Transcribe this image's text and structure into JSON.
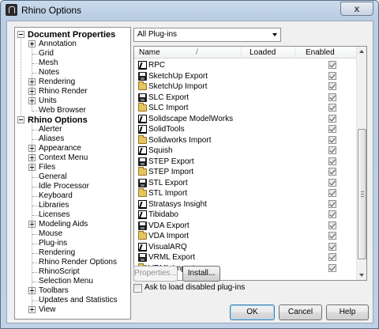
{
  "window": {
    "title": "Rhino Options",
    "close_label": "x"
  },
  "tree": {
    "items": [
      {
        "label": "Document Properties",
        "bold": true,
        "level": 0,
        "expander": "minus"
      },
      {
        "label": "Annotation",
        "level": 1,
        "expander": "plus"
      },
      {
        "label": "Grid",
        "level": 1
      },
      {
        "label": "Mesh",
        "level": 1
      },
      {
        "label": "Notes",
        "level": 1
      },
      {
        "label": "Rendering",
        "level": 1,
        "expander": "plus"
      },
      {
        "label": "Rhino Render",
        "level": 1,
        "expander": "plus"
      },
      {
        "label": "Units",
        "level": 1,
        "expander": "plus"
      },
      {
        "label": "Web Browser",
        "level": 1
      },
      {
        "label": "Rhino Options",
        "bold": true,
        "level": 0,
        "expander": "minus"
      },
      {
        "label": "Alerter",
        "level": 1
      },
      {
        "label": "Aliases",
        "level": 1
      },
      {
        "label": "Appearance",
        "level": 1,
        "expander": "plus"
      },
      {
        "label": "Context Menu",
        "level": 1,
        "expander": "plus"
      },
      {
        "label": "Files",
        "level": 1,
        "expander": "plus"
      },
      {
        "label": "General",
        "level": 1
      },
      {
        "label": "Idle Processor",
        "level": 1
      },
      {
        "label": "Keyboard",
        "level": 1
      },
      {
        "label": "Libraries",
        "level": 1
      },
      {
        "label": "Licenses",
        "level": 1
      },
      {
        "label": "Modeling Aids",
        "level": 1,
        "expander": "plus"
      },
      {
        "label": "Mouse",
        "level": 1
      },
      {
        "label": "Plug-ins",
        "level": 1
      },
      {
        "label": "Rendering",
        "level": 1
      },
      {
        "label": "Rhino Render Options",
        "level": 1
      },
      {
        "label": "RhinoScript",
        "level": 1
      },
      {
        "label": "Selection Menu",
        "level": 1
      },
      {
        "label": "Toolbars",
        "level": 1,
        "expander": "plus"
      },
      {
        "label": "Updates and Statistics",
        "level": 1
      },
      {
        "label": "View",
        "level": 1,
        "expander": "plus"
      }
    ]
  },
  "filter": {
    "selected": "All Plug-ins"
  },
  "plugin_list": {
    "columns": [
      "Name",
      "Loaded",
      "Enabled"
    ],
    "sort_glyph": "/",
    "rows": [
      {
        "name": "RPC",
        "icon": "command-icon",
        "enabled": true
      },
      {
        "name": "SketchUp Export",
        "icon": "save-icon",
        "enabled": true
      },
      {
        "name": "SketchUp Import",
        "icon": "folder-icon",
        "enabled": true
      },
      {
        "name": "SLC Export",
        "icon": "save-icon",
        "enabled": true
      },
      {
        "name": "SLC Import",
        "icon": "folder-icon",
        "enabled": true
      },
      {
        "name": "Solidscape ModelWorks",
        "icon": "command-icon",
        "enabled": true
      },
      {
        "name": "SolidTools",
        "icon": "command-icon",
        "enabled": true
      },
      {
        "name": "Solidworks Import",
        "icon": "folder-icon",
        "enabled": true
      },
      {
        "name": "Squish",
        "icon": "command-icon",
        "enabled": true
      },
      {
        "name": "STEP Export",
        "icon": "save-icon",
        "enabled": true
      },
      {
        "name": "STEP Import",
        "icon": "folder-icon",
        "enabled": true
      },
      {
        "name": "STL Export",
        "icon": "save-icon",
        "enabled": true
      },
      {
        "name": "STL Import",
        "icon": "folder-icon",
        "enabled": true
      },
      {
        "name": "Stratasys Insight",
        "icon": "command-icon",
        "enabled": true
      },
      {
        "name": "Tibidabo",
        "icon": "command-icon",
        "enabled": true
      },
      {
        "name": "VDA Export",
        "icon": "save-icon",
        "enabled": true
      },
      {
        "name": "VDA Import",
        "icon": "folder-icon",
        "enabled": true
      },
      {
        "name": "VisualARQ",
        "icon": "command-icon",
        "enabled": true
      },
      {
        "name": "VRML Export",
        "icon": "save-icon",
        "enabled": true
      },
      {
        "name": "VRML Import",
        "icon": "folder-icon",
        "enabled": true
      }
    ]
  },
  "buttons": {
    "properties": "Properties...",
    "install": "Install...",
    "ok": "OK",
    "cancel": "Cancel",
    "help": "Help"
  },
  "ask_disabled": {
    "label": "Ask to load disabled plug-ins",
    "checked": false
  }
}
